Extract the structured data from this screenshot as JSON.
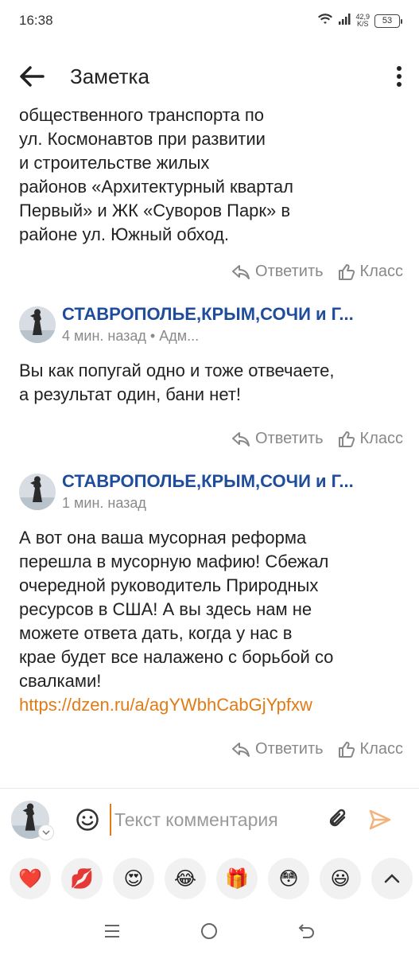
{
  "status_bar": {
    "time": "16:38",
    "net_speed_value": "42,9",
    "net_speed_unit": "K/S",
    "battery": "53"
  },
  "header": {
    "title": "Заметка"
  },
  "post_tail": {
    "lines": [
      "общественного транспорта по",
      "ул. Космонавтов при развитии",
      "и строительстве жилых",
      "районов «Архитектурный квартал",
      "Первый» и ЖК «Суворов Парк» в",
      "районе ул. Южный обход."
    ]
  },
  "actions": {
    "reply_label": "Ответить",
    "like_label": "Класс"
  },
  "comments": [
    {
      "author": "СТАВРОПОЛЬЕ,КРЫМ,СОЧИ и Г...",
      "time": "4 мин. назад • Адм...",
      "lines": [
        "Вы как попугай одно и тоже отвечаете,",
        "а результат один, бани нет!"
      ]
    },
    {
      "author": "СТАВРОПОЛЬЕ,КРЫМ,СОЧИ и Г...",
      "time": "1 мин. назад",
      "lines": [
        "А вот она ваша мусорная реформа",
        "перешла в мусорную мафию! Сбежал",
        "очередной руководитель Природных",
        "ресурсов в США! А вы здесь нам не",
        "можете ответа дать, когда у нас в",
        "крае будет все налажено с борьбой со",
        "свалками!"
      ],
      "link": "https://dzen.ru/a/agYWbhCabGjYpfxw"
    }
  ],
  "composer": {
    "placeholder": "Текст комментария"
  },
  "reactions": [
    "❤️",
    "💋",
    "😍",
    "😂",
    "🎁",
    "😳",
    "😃"
  ],
  "colors": {
    "author": "#1f4d9c",
    "link": "#e37b14",
    "muted": "#888888",
    "send": "#f2b27a"
  }
}
